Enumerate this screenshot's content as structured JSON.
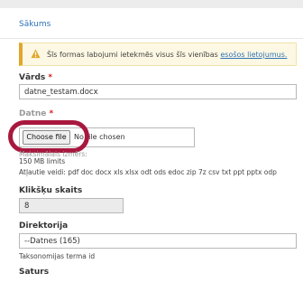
{
  "breadcrumb": "Sākums",
  "warning": {
    "text": "Šīs formas labojumi ietekmēs visus šīs vienības",
    "link": "esošos lietojumus."
  },
  "fields": {
    "name": {
      "label": "Vārds",
      "required_mark": "*",
      "value": "datne_testam.docx"
    },
    "file": {
      "label": "Datne",
      "required_mark": "*",
      "button_label": "Choose file",
      "status": "No file chosen",
      "help_partial": "Maksimālais izmērs:",
      "size_limit": "150 MB limits",
      "allowed_types": "Atļautie veidi: pdf doc docx xls xlsx odt ods edoc zip 7z csv txt ppt pptx odp"
    },
    "clicks": {
      "label": "Klikšķu skaits",
      "value": "8"
    },
    "directory": {
      "label": "Direktorija",
      "value": "--Datnes (165)",
      "help": "Taksonomijas terma id"
    },
    "content": {
      "label": "Saturs"
    }
  },
  "colors": {
    "link": "#2e73b8",
    "warning_border": "#e1a62b",
    "required": "#d21f1f",
    "highlight": "#a8183e"
  }
}
